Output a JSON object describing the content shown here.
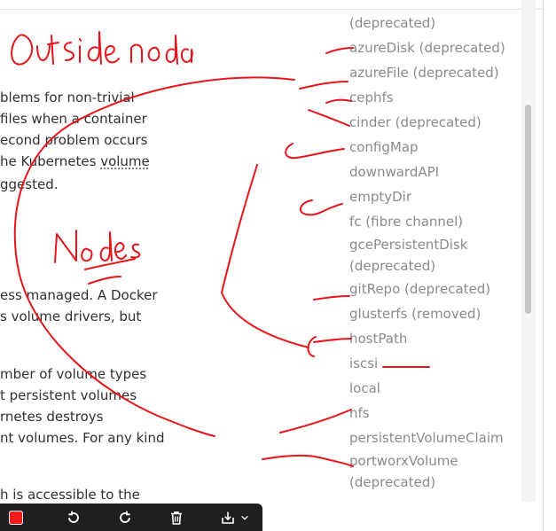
{
  "article": {
    "lines": [
      "blems for non-trivial",
      "files when a container",
      "econd problem occurs",
      "he Kubernetes ",
      "ggested.",
      "ess managed. A Docker",
      "s volume drivers, but",
      "mber of volume types",
      "t persistent volumes",
      "rnetes destroys",
      "nt volumes. For any kind",
      "h is accessible to the"
    ],
    "volume_link": "volume"
  },
  "volume_types": [
    "(deprecated)",
    "azureDisk (deprecated)",
    "azureFile (deprecated)",
    "cephfs",
    "cinder (deprecated)",
    "configMap",
    "downwardAPI",
    "emptyDir",
    "fc (fibre channel)",
    "gcePersistentDisk",
    "(deprecated)",
    "gitRepo (deprecated)",
    "glusterfs (removed)",
    "hostPath",
    "iscsi",
    "local",
    "nfs",
    "persistentVolumeClaim",
    "portworxVolume",
    "(deprecated)"
  ],
  "annotations": {
    "outside_label": "Outside node",
    "nodes_label": "Nodes",
    "ink_color": "#e8141c"
  },
  "toolbar": {
    "icons": [
      "color-swatch",
      "undo-icon",
      "redo-icon",
      "trash-icon",
      "save-icon",
      "chevron-down-icon"
    ],
    "active_color": "#ff1a1a"
  }
}
